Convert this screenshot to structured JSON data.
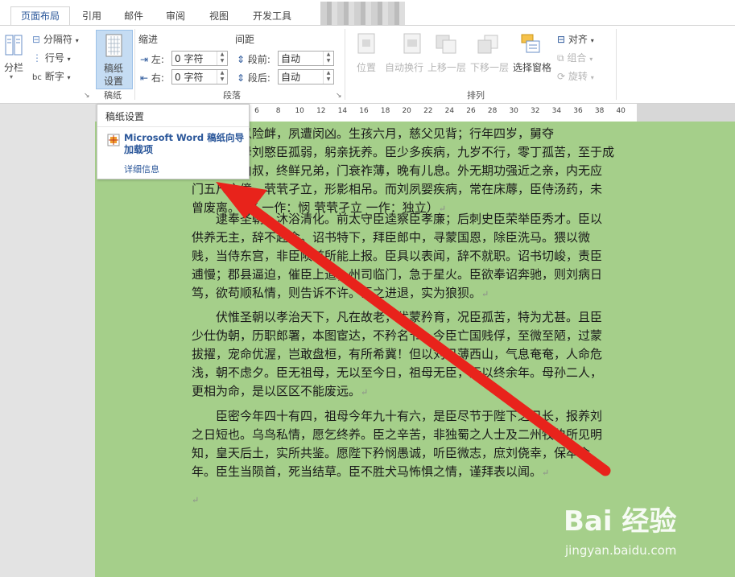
{
  "tabs": [
    "页面布局",
    "引用",
    "邮件",
    "审阅",
    "视图",
    "开发工具"
  ],
  "ribbon": {
    "columns_label": "分栏",
    "breaks_label": "分隔符",
    "line_numbers_label": "行号",
    "hyphenation_label": "断字",
    "manuscript_label_1": "稿纸",
    "manuscript_label_2": "设置",
    "manuscript_group": "稿纸",
    "indent_label": "缩进",
    "indent_left_label": "左:",
    "indent_left_value": "0 字符",
    "indent_right_label": "右:",
    "indent_right_value": "0 字符",
    "spacing_label": "间距",
    "spacing_before_label": "段前:",
    "spacing_before_value": "自动",
    "spacing_after_label": "段后:",
    "spacing_after_value": "自动",
    "paragraph_group": "段落",
    "position_label": "位置",
    "wrap_label": "自动换行",
    "bring_forward_label": "上移一层",
    "send_backward_label": "下移一层",
    "selection_pane_label": "选择窗格",
    "align_label": "对齐",
    "group_label": "组合",
    "rotate_label": "旋转",
    "arrange_group": "排列"
  },
  "ruler_numbers": [
    "6",
    "8",
    "10",
    "12",
    "14",
    "16",
    "18",
    "20",
    "22",
    "24",
    "26",
    "28",
    "30",
    "32",
    "34",
    "36",
    "38",
    "40"
  ],
  "tooltip": {
    "title": "稿纸设置",
    "addin_line1": "Microsoft Word 稿纸向导",
    "addin_line2": "加载项",
    "more_link": "详细信息"
  },
  "document": {
    "p1": [
      "……。臣以险衅，夙遭闵凶。生孩六月，慈父见背；行年四岁，舅夺",
      "母志。祖母刘愍臣孤弱，躬亲抚养。臣少多疾病，九岁不行，零丁孤苦，至于成",
      "立。既无伯叔，终鲜兄弟，门衰祚薄，晚有儿息。外无期功强近之亲，内无应",
      "门五尺之僮，茕茕孑立，形影相吊。而刘夙婴疾病，常在床蓐，臣侍汤药，未",
      "曾废离。（愍  一作：悯  茕茕孑立  一作：独立）"
    ],
    "p2": [
      "逮奉圣朝，沐浴清化。前太守臣逵察臣孝廉；后刺史臣荣举臣秀才。臣以",
      "供养无主，辞不赴命。诏书特下，拜臣郎中，寻蒙国恩，除臣洗马。猥以微",
      "贱，当侍东宫，非臣陨首所能上报。臣具以表闻，辞不就职。诏书切峻，责臣",
      "逋慢；郡县逼迫，催臣上道；州司临门，急于星火。臣欲奉诏奔驰，则刘病日",
      "笃，欲苟顺私情，则告诉不许。臣之进退，实为狼狈。"
    ],
    "p3": [
      "伏惟圣朝以孝治天下，凡在故老，犹蒙矜育，况臣孤苦，特为尤甚。且臣",
      "少仕伪朝，历职郎署，本图宦达，不矜名节。今臣亡国贱俘，至微至陋，过蒙",
      "拔擢，宠命优渥，岂敢盘桓，有所希冀！但以刘日薄西山，气息奄奄，人命危",
      "浅，朝不虑夕。臣无祖母，无以至今日，祖母无臣，无以终余年。母孙二人，",
      "更相为命，是以区区不能废远。"
    ],
    "p4": [
      "臣密今年四十有四，祖母今年九十有六，是臣尽节于陛下之日长，报养刘",
      "之日短也。乌鸟私情，愿乞终养。臣之辛苦，非独蜀之人士及二州牧伯所见明",
      "知，皇天后土，实所共鉴。愿陛下矜悯愚诚，听臣微志，庶刘侥幸，保卒余",
      "年。臣生当陨首，死当结草。臣不胜犬马怖惧之情，谨拜表以闻。"
    ],
    "para_mark": "↵"
  },
  "watermark": {
    "brand": "Bai 经验",
    "url": "jingyan.baidu.com"
  },
  "colors": {
    "page": "#a5cf8a",
    "accent": "#2b579a",
    "arrow": "#e8231b"
  }
}
